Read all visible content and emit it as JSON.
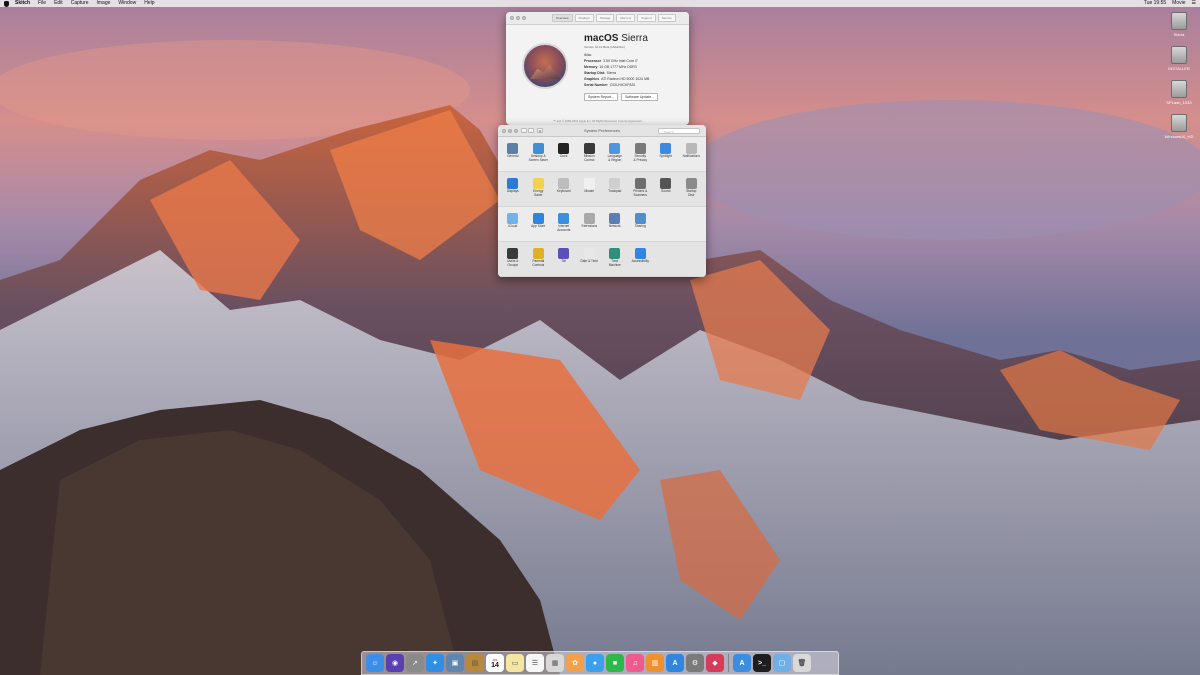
{
  "menubar": {
    "app": "Skitch",
    "items": [
      "File",
      "Edit",
      "Capture",
      "Image",
      "Window",
      "Help"
    ],
    "clock": "Tue 19:55",
    "right_app": "Movie"
  },
  "desktop_volumes": [
    "Sierra",
    "INSTALLER",
    "SPLash_1033",
    "Windows10_HD"
  ],
  "about": {
    "tabs": [
      "Overview",
      "Displays",
      "Storage",
      "Memory",
      "Support",
      "Service"
    ],
    "os_name_bold": "macOS",
    "os_name": "Sierra",
    "version": "Version 10.12 Beta (16A201w)",
    "model": "iMac",
    "specs": [
      {
        "k": "Processor",
        "v": "3.59 GHz Intel Core i7"
      },
      {
        "k": "Memory",
        "v": "16 GB 1777 MHz DDR3"
      },
      {
        "k": "Startup Disk",
        "v": "Sierra"
      },
      {
        "k": "Graphics",
        "v": "ATI Radeon HD 5000 1024 MB"
      },
      {
        "k": "Serial Number",
        "v": "C02LH4CKF8J0"
      }
    ],
    "btn_report": "System Report...",
    "btn_update": "Software Update...",
    "footer": "™ and © 1983-2016 Apple Inc. All Rights Reserved. License Agreement"
  },
  "syspref": {
    "title": "System Preferences",
    "search_placeholder": "Search",
    "rows": [
      [
        {
          "label": "General",
          "icon": "general-icon",
          "color": "#5b7fa6"
        },
        {
          "label": "Desktop &\nScreen Saver",
          "icon": "desktop-icon",
          "color": "#3f8fd6"
        },
        {
          "label": "Dock",
          "icon": "dock-icon",
          "color": "#222222"
        },
        {
          "label": "Mission\nControl",
          "icon": "mission-control-icon",
          "color": "#3a3a3a"
        },
        {
          "label": "Language\n& Region",
          "icon": "language-icon",
          "color": "#4d97e0"
        },
        {
          "label": "Security\n& Privacy",
          "icon": "security-icon",
          "color": "#7a7a7a"
        },
        {
          "label": "Spotlight",
          "icon": "spotlight-icon",
          "color": "#3d8be0"
        },
        {
          "label": "Notifications",
          "icon": "notifications-icon",
          "color": "#b8b8b8"
        }
      ],
      [
        {
          "label": "Displays",
          "icon": "displays-icon",
          "color": "#2d7ad6"
        },
        {
          "label": "Energy\nSaver",
          "icon": "energy-icon",
          "color": "#f2d24a"
        },
        {
          "label": "Keyboard",
          "icon": "keyboard-icon",
          "color": "#bdbdbd"
        },
        {
          "label": "Mouse",
          "icon": "mouse-icon",
          "color": "#f0f0f0"
        },
        {
          "label": "Trackpad",
          "icon": "trackpad-icon",
          "color": "#cfcfcf"
        },
        {
          "label": "Printers &\nScanners",
          "icon": "printer-icon",
          "color": "#6e6e6e"
        },
        {
          "label": "Sound",
          "icon": "sound-icon",
          "color": "#555555"
        },
        {
          "label": "Startup\nDisk",
          "icon": "startup-disk-icon",
          "color": "#8a8a8a"
        }
      ],
      [
        {
          "label": "iCloud",
          "icon": "icloud-icon",
          "color": "#6fb2ee"
        },
        {
          "label": "App Store",
          "icon": "app-store-icon",
          "color": "#2f86e0"
        },
        {
          "label": "Internet\nAccounts",
          "icon": "internet-accounts-icon",
          "color": "#3b8fe0"
        },
        {
          "label": "Extensions",
          "icon": "extensions-icon",
          "color": "#a9a9a9"
        },
        {
          "label": "Network",
          "icon": "network-icon",
          "color": "#5a7fb8"
        },
        {
          "label": "Sharing",
          "icon": "sharing-icon",
          "color": "#4f8fd0"
        }
      ],
      [
        {
          "label": "Users &\nGroups",
          "icon": "users-icon",
          "color": "#3a3a3a"
        },
        {
          "label": "Parental\nControls",
          "icon": "parental-controls-icon",
          "color": "#e0b020"
        },
        {
          "label": "Siri",
          "icon": "siri-icon",
          "color": "#5b4fb8"
        },
        {
          "label": "Date & Time",
          "icon": "date-time-icon",
          "color": "#e8e8e8"
        },
        {
          "label": "Time\nMachine",
          "icon": "time-machine-icon",
          "color": "#2f8f7a"
        },
        {
          "label": "Accessibility",
          "icon": "accessibility-icon",
          "color": "#2f86e0"
        }
      ]
    ]
  },
  "dock": {
    "apps": [
      {
        "name": "finder-icon",
        "color": "#3d8ee8",
        "glyph": "☺"
      },
      {
        "name": "siri-icon",
        "color": "#5a3fb0",
        "glyph": "◉"
      },
      {
        "name": "launchpad-icon",
        "color": "#8a8a8a",
        "glyph": "➚"
      },
      {
        "name": "safari-icon",
        "color": "#2f8fe6",
        "glyph": "✦"
      },
      {
        "name": "preview-icon",
        "color": "#5f86b0",
        "glyph": "▣"
      },
      {
        "name": "notes-icon",
        "color": "#b8893a",
        "glyph": "▤"
      },
      {
        "name": "calendar-icon",
        "color": "#ffffff",
        "glyph": "14"
      },
      {
        "name": "stickies-icon",
        "color": "#f4e7a0",
        "glyph": "▭"
      },
      {
        "name": "reminders-icon",
        "color": "#f7f7f7",
        "glyph": "☰"
      },
      {
        "name": "photos-app-icon",
        "color": "#d8d8d8",
        "glyph": "▦"
      },
      {
        "name": "photos-icon",
        "color": "#f3a04a",
        "glyph": "✿"
      },
      {
        "name": "messages-icon",
        "color": "#3aa0ee",
        "glyph": "●"
      },
      {
        "name": "facetime-icon",
        "color": "#2fb84a",
        "glyph": "■"
      },
      {
        "name": "itunes-icon",
        "color": "#ef5b8f",
        "glyph": "♫"
      },
      {
        "name": "ibooks-icon",
        "color": "#f0912e",
        "glyph": "▥"
      },
      {
        "name": "app-store-icon",
        "color": "#2f86e0",
        "glyph": "A"
      },
      {
        "name": "system-preferences-icon",
        "color": "#7a7a7a",
        "glyph": "⚙"
      },
      {
        "name": "ruby-app-icon",
        "color": "#d83a5a",
        "glyph": "◆"
      }
    ],
    "others": [
      {
        "name": "app-store-download-icon",
        "color": "#3a8ee0",
        "glyph": "A"
      },
      {
        "name": "terminal-icon",
        "color": "#1e1e1e",
        "glyph": ">_"
      },
      {
        "name": "downloads-folder-icon",
        "color": "#6fb0e8",
        "glyph": "▢"
      },
      {
        "name": "trash-icon",
        "color": "#d9d9d9",
        "glyph": "🗑"
      }
    ],
    "calendar_month": "JUL"
  }
}
